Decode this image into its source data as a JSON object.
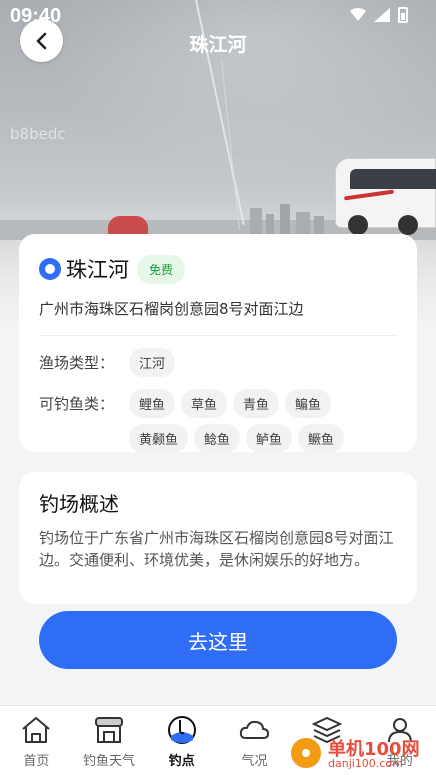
{
  "status_bar": {
    "time": "09:40"
  },
  "header": {
    "title": "珠江河"
  },
  "hero": {
    "watermark": "b8bedc"
  },
  "spot": {
    "name": "珠江河",
    "fee_badge": "免费",
    "address": "广州市海珠区石榴岗创意园8号对面江边",
    "type_label": "渔场类型：",
    "types": [
      "江河"
    ],
    "fish_label": "可钓鱼类：",
    "fish": [
      "鲤鱼",
      "草鱼",
      "青鱼",
      "鳊鱼",
      "黄颡鱼",
      "鲶鱼",
      "鲈鱼",
      "鳜鱼"
    ]
  },
  "overview": {
    "title": "钓场概述",
    "text": "钓场位于广东省广州市海珠区石榴岗创意园8号对面江边。交通便利、环境优美，是休闲娱乐的好地方。"
  },
  "action": {
    "go_label": "去这里"
  },
  "tabbar": {
    "items": [
      {
        "label": "首页",
        "icon": "home-icon"
      },
      {
        "label": "钓鱼天气",
        "icon": "weather-shop-icon"
      },
      {
        "label": "钓点",
        "icon": "fishing-spot-icon",
        "active": true
      },
      {
        "label": "气况",
        "icon": "cloud-icon"
      },
      {
        "label": "",
        "icon": "layers-icon"
      },
      {
        "label": "我的",
        "icon": "user-icon"
      }
    ]
  },
  "promo": {
    "title": "单机100网",
    "url": "danji100.com"
  },
  "colors": {
    "accent": "#2f6df6",
    "free": "#1f9d3d"
  }
}
